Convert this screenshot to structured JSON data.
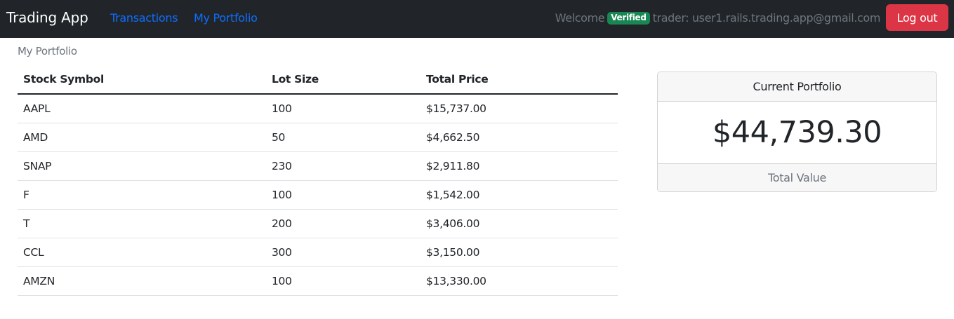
{
  "navbar": {
    "brand": "Trading App",
    "links": [
      "Transactions",
      "My Portfolio"
    ],
    "welcome_prefix": "Welcome",
    "badge": "Verified",
    "user_text": "trader: user1.rails.trading.app@gmail.com",
    "logout_label": "Log out"
  },
  "portfolio": {
    "title": "My Portfolio",
    "columns": [
      "Stock Symbol",
      "Lot Size",
      "Total Price"
    ],
    "rows": [
      {
        "symbol": "AAPL",
        "lot": "100",
        "price": "$15,737.00"
      },
      {
        "symbol": "AMD",
        "lot": "50",
        "price": "$4,662.50"
      },
      {
        "symbol": "SNAP",
        "lot": "230",
        "price": "$2,911.80"
      },
      {
        "symbol": "F",
        "lot": "100",
        "price": "$1,542.00"
      },
      {
        "symbol": "T",
        "lot": "200",
        "price": "$3,406.00"
      },
      {
        "symbol": "CCL",
        "lot": "300",
        "price": "$3,150.00"
      },
      {
        "symbol": "AMZN",
        "lot": "100",
        "price": "$13,330.00"
      }
    ]
  },
  "summary": {
    "header": "Current Portfolio",
    "value": "$44,739.30",
    "footer": "Total Value"
  },
  "colors": {
    "navbar_bg": "#212529",
    "link": "#0d6efd",
    "badge": "#198754",
    "logout": "#dc3545"
  }
}
